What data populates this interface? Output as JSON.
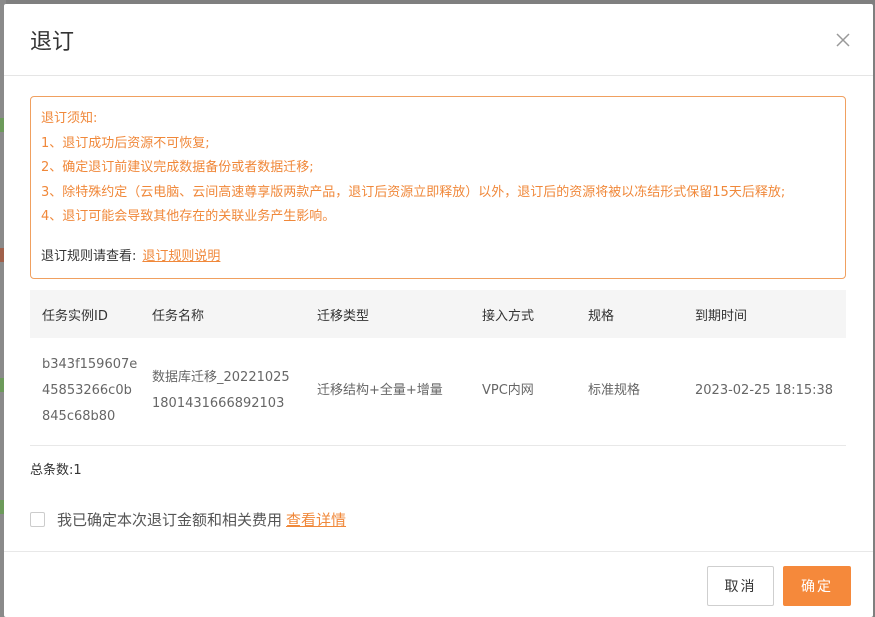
{
  "dialog": {
    "title": "退订",
    "close_icon": "close-icon"
  },
  "notice": {
    "heading": "退订须知:",
    "lines": [
      "1、退订成功后资源不可恢复;",
      "2、确定退订前建议完成数据备份或者数据迁移;",
      "3、除特殊约定（云电脑、云间高速尊享版两款产品，退订后资源立即释放）以外，退订后的资源将被以冻结形式保留15天后释放;",
      "4、退订可能会导致其他存在的关联业务产生影响。"
    ],
    "rule_label": "退订规则请查看:",
    "rule_link": "退订规则说明"
  },
  "table": {
    "headers": [
      "任务实例ID",
      "任务名称",
      "迁移类型",
      "接入方式",
      "规格",
      "到期时间"
    ],
    "rows": [
      {
        "id_lines": [
          "b343f159607e",
          "45853266c0b",
          "845c68b80"
        ],
        "name_lines": [
          "数据库迁移_20221025",
          "1801431666892103"
        ],
        "migration_type": "迁移结构+全量+增量",
        "access": "VPC内网",
        "spec": "标准规格",
        "expire": "2023-02-25 18:15:38"
      }
    ]
  },
  "total": "总条数:1",
  "confirm": {
    "text": "我已确定本次退订金额和相关费用",
    "link": "查看详情",
    "checked": false
  },
  "footer": {
    "cancel": "取消",
    "ok": "确定"
  },
  "colors": {
    "accent": "#f5893b",
    "notice_text": "#f0883a"
  }
}
